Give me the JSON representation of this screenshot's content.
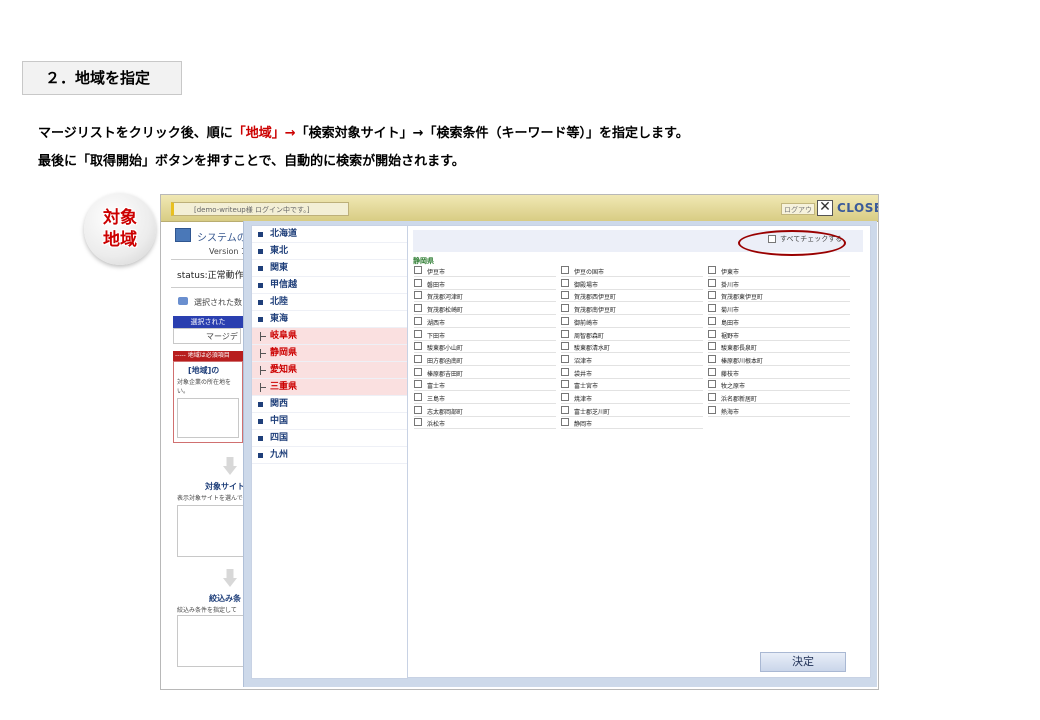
{
  "heading": "２．地域を指定",
  "instruction": {
    "line1_prefix": "マージリストをクリック後、順に",
    "line1_highlight": "「地域」→",
    "line1_suffix": "「検索対象サイト」→「検索条件（キーワード等）」を指定します。",
    "line2": "最後に「取得開始」ボタンを押すことで、自動的に検索が開始されます。"
  },
  "badge": {
    "line1": "対象",
    "line2": "地域"
  },
  "topbar": {
    "login_text": "[demo-writeup様 ログイン中です。]",
    "logout_label": "ログアウ",
    "close_label": "CLOSE"
  },
  "app": {
    "system_title": "システムの",
    "version": "Version 1",
    "status": "status:正常動作",
    "selected_label": "選択された数",
    "selected_header": "選択された",
    "merge_label": "マージデ",
    "region_warning": "----- 地域は必須項目",
    "region_heading": "[地域]の",
    "region_desc_1": "対象企業の所在地を",
    "region_desc_2": "い。",
    "target_sites": "対象サイト",
    "target_sites_desc": "表示対象サイトを選んで",
    "filter": "絞込み条",
    "filter_desc": "絞込み条件を指定して"
  },
  "regions": [
    {
      "label": "北海道",
      "sub": false
    },
    {
      "label": "東北",
      "sub": false
    },
    {
      "label": "関東",
      "sub": false
    },
    {
      "label": "甲信越",
      "sub": false
    },
    {
      "label": "北陸",
      "sub": false
    },
    {
      "label": "東海",
      "sub": false
    },
    {
      "label": "岐阜県",
      "sub": true
    },
    {
      "label": "静岡県",
      "sub": true
    },
    {
      "label": "愛知県",
      "sub": true
    },
    {
      "label": "三重県",
      "sub": true
    },
    {
      "label": "関西",
      "sub": false
    },
    {
      "label": "中国",
      "sub": false
    },
    {
      "label": "四国",
      "sub": false
    },
    {
      "label": "九州",
      "sub": false
    }
  ],
  "check_all_label": "すべてチェックする",
  "prefecture_title": "静岡県",
  "cities": [
    "伊豆市",
    "伊豆の国市",
    "伊東市",
    "磐田市",
    "御殿場市",
    "掛川市",
    "賀茂郡河津町",
    "賀茂郡西伊豆町",
    "賀茂郡東伊豆町",
    "賀茂郡松崎町",
    "賀茂郡南伊豆町",
    "菊川市",
    "湖西市",
    "御前崎市",
    "島田市",
    "下田市",
    "周智郡森町",
    "裾野市",
    "駿東郡小山町",
    "駿東郡清水町",
    "駿東郡長泉町",
    "田方郡函南町",
    "沼津市",
    "榛原郡川根本町",
    "榛原郡吉田町",
    "袋井市",
    "藤枝市",
    "富士市",
    "富士宮市",
    "牧之原市",
    "三島市",
    "焼津市",
    "浜名郡新居町",
    "志太郡岡部町",
    "富士郡芝川町",
    "熱海市",
    "浜松市",
    "静岡市"
  ],
  "confirm_label": "決定"
}
